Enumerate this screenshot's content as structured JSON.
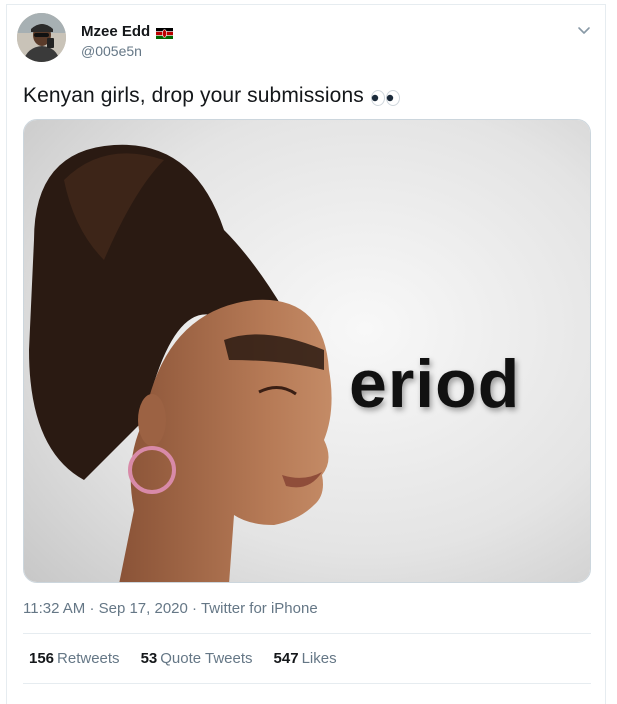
{
  "tweet": {
    "author": {
      "display_name": "Mzee Edd",
      "handle": "@005e5n",
      "flag_icon": "kenya-flag-icon"
    },
    "text": "Kenyan girls, drop your submissions",
    "emoji_icon": "eyes-icon",
    "media": {
      "overlay_text": "eriod"
    },
    "meta": {
      "time": "11:32 AM",
      "date": "Sep 17, 2020",
      "source": "Twitter for iPhone",
      "separator": "·"
    },
    "stats": {
      "retweets_count": "156",
      "retweets_label": "Retweets",
      "quotes_count": "53",
      "quotes_label": "Quote Tweets",
      "likes_count": "547",
      "likes_label": "Likes"
    }
  },
  "colors": {
    "text_primary": "#14171a",
    "text_secondary": "#657786",
    "border": "#e6ecf0"
  }
}
